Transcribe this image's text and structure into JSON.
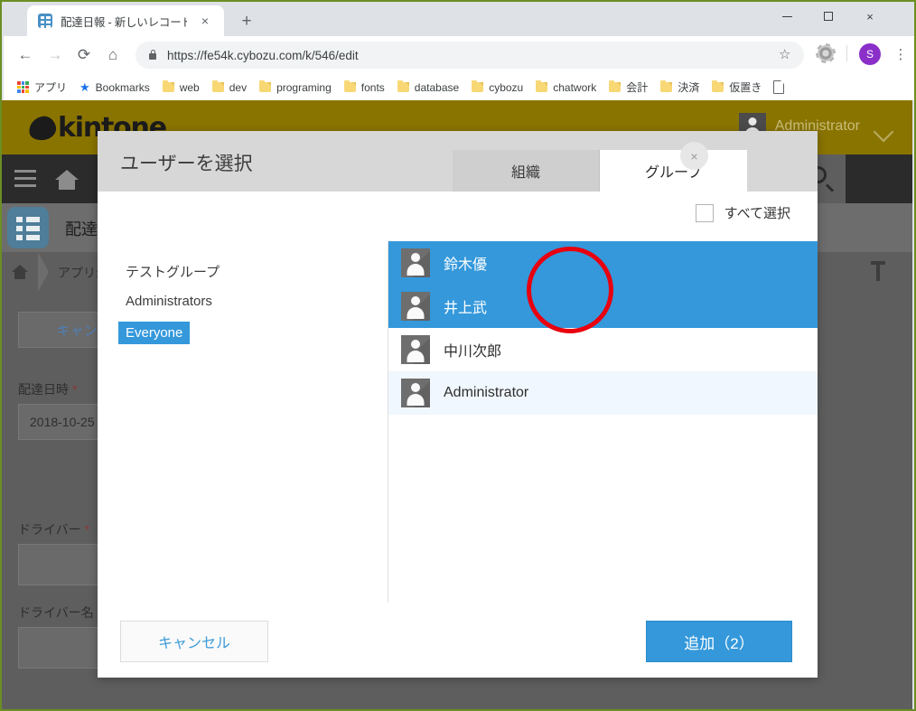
{
  "browser": {
    "tab": {
      "title": "配達日報 - 新しいレコード",
      "favicon": "kintone-favicon",
      "close": "×"
    },
    "new_tab": "+",
    "window_controls": {
      "minimize": "minimize-icon",
      "maximize": "maximize-icon",
      "close": "×"
    },
    "nav": {
      "back": "←",
      "forward": "→",
      "reload": "⟳",
      "home": "⌂"
    },
    "omnibox": {
      "url": "https://fe54k.cybozu.com/k/546/edit",
      "lock": "lock-icon",
      "star": "☆"
    },
    "extension_icon": "gear-extension-icon",
    "profile": {
      "initial": "S"
    },
    "menu": "⋮",
    "bookmarks": [
      {
        "label": "アプリ",
        "icon": "apps-grid-icon"
      },
      {
        "label": "Bookmarks",
        "icon": "star-icon"
      },
      {
        "label": "web",
        "icon": "folder-icon"
      },
      {
        "label": "dev",
        "icon": "folder-icon"
      },
      {
        "label": "programing",
        "icon": "folder-icon"
      },
      {
        "label": "fonts",
        "icon": "folder-icon"
      },
      {
        "label": "database",
        "icon": "folder-icon"
      },
      {
        "label": "cybozu",
        "icon": "folder-icon"
      },
      {
        "label": "chatwork",
        "icon": "folder-icon"
      },
      {
        "label": "会計",
        "icon": "folder-icon"
      },
      {
        "label": "決済",
        "icon": "folder-icon"
      },
      {
        "label": "仮置き",
        "icon": "folder-icon"
      }
    ],
    "overflow_icon": "page-document-icon"
  },
  "page": {
    "brand": "kintone",
    "user": {
      "name": "Administrator",
      "avatar": "user-avatar-icon",
      "chevron": "chevron-down-icon"
    },
    "nav": {
      "menu": "hamburger-icon",
      "home": "home-icon",
      "search": "search-icon",
      "pin": "pin-icon"
    },
    "app": {
      "icon": "app-list-icon",
      "name": "配達日"
    },
    "breadcrumb": {
      "home": "home-icon",
      "text": "アプリ: 配"
    },
    "record": {
      "cancel_label": "キャン",
      "fields": [
        {
          "label": "配達日時",
          "required": "*",
          "value": "2018-10-25"
        },
        {
          "label": "ドライバー",
          "required": "*",
          "value": ""
        },
        {
          "label": "ドライバー名",
          "required": "",
          "value": ""
        }
      ]
    }
  },
  "dialog": {
    "title": "ユーザーを選択",
    "close_icon": "×",
    "tabs": [
      {
        "label": "組織",
        "active": false
      },
      {
        "label": "グループ",
        "active": true
      }
    ],
    "select_all": {
      "label": "すべて選択",
      "checked": false
    },
    "groups": [
      {
        "label": "テストグループ",
        "selected": false
      },
      {
        "label": "Administrators",
        "selected": false
      },
      {
        "label": "Everyone",
        "selected": true
      }
    ],
    "users": [
      {
        "name": "鈴木優",
        "avatar": "user-avatar-icon",
        "state": "selected"
      },
      {
        "name": "井上武",
        "avatar": "user-avatar-icon",
        "state": "selected"
      },
      {
        "name": "中川次郎",
        "avatar": "user-avatar-icon",
        "state": "normal"
      },
      {
        "name": "Administrator",
        "avatar": "user-avatar-icon",
        "state": "hover"
      }
    ],
    "footer": {
      "cancel_label": "キャンセル",
      "add_label": "追加（2）",
      "selected_count": 2
    }
  },
  "annotation": {
    "shape": "circle",
    "color": "#e8000f"
  },
  "colors": {
    "accent_blue": "#3498db",
    "dialog_header": "#d7d7d7",
    "hover_row": "#f0f7fe",
    "kintone_gold": "#8a7400",
    "window_border": "#6b8e23"
  }
}
